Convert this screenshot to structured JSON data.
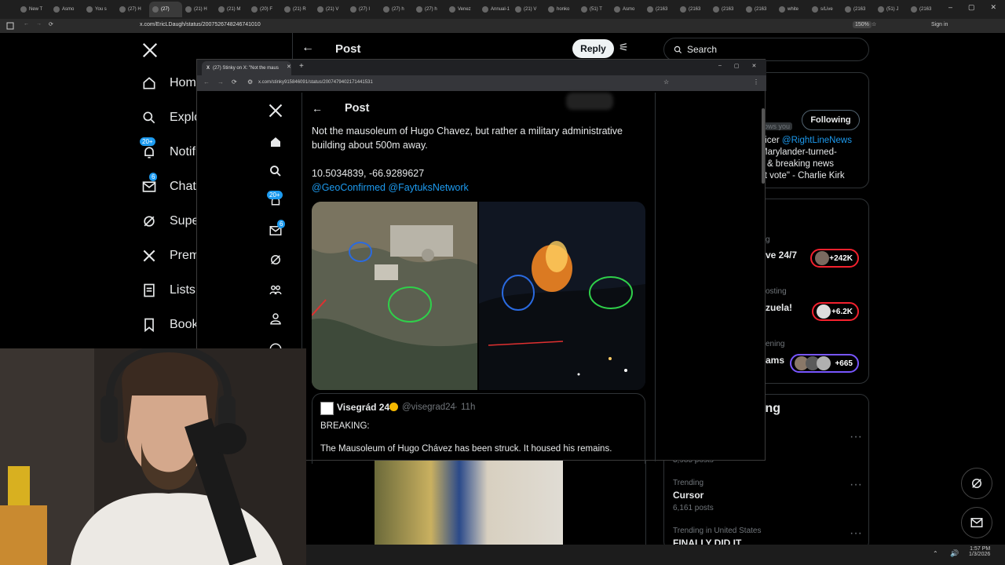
{
  "outer_browser": {
    "tabs": [
      "New T",
      "Asmo",
      "You s",
      "(27) H",
      "(27) ",
      "(21) H",
      "(21) M",
      "(20) F",
      "(21) R",
      "(21) V",
      "(27) I",
      "(27) h",
      "(27) h",
      "Venez",
      "Annual-1",
      "(21) V",
      "honko",
      "(51) T",
      "Asmo",
      "(2163",
      "(2163",
      "(2163",
      "(2163",
      "white",
      "s/Live",
      "(2163",
      "(51) J",
      "(2163"
    ],
    "url": "x.com/EricLDaugh/status/2007526748246741010",
    "zoom": "150%",
    "signin": "Sign in"
  },
  "bg_sidebar": {
    "items": [
      "Home",
      "Explore",
      "Notifications",
      "Chat",
      "Super",
      "Premium",
      "Lists",
      "Bookmarks"
    ],
    "notif_badge": "20+",
    "chat_badge": "6"
  },
  "bg_header": {
    "title": "Post",
    "reply": "Reply"
  },
  "search": {
    "placeholder": "Search"
  },
  "right_col": {
    "follow_card": {
      "button": "Following",
      "follows_you": "lows you",
      "bio_line1_prefix": "fficer ",
      "bio_handle": "@RightLineNews",
      "bio_line2": " Marylander-turned-",
      "bio_line3": "s & breaking news",
      "bio_line4": "st vote\" - Charlie Kirk"
    },
    "live": [
      {
        "label": "ve 24/7",
        "count": "+242K"
      },
      {
        "label": "zuela!",
        "count": "+6.2K"
      },
      {
        "label": "ams",
        "count": "+665"
      }
    ],
    "live_faint": [
      "g",
      "osting",
      "ening"
    ],
    "trending_heading": "ing",
    "trends": [
      {
        "context": "",
        "name": "",
        "posts": "3,985 posts"
      },
      {
        "context": "Trending",
        "name": "Cursor",
        "posts": "6,161 posts"
      },
      {
        "context": "Trending in United States",
        "name": "FINALLY DID IT",
        "posts": ""
      }
    ]
  },
  "popup": {
    "tab_title": "(27) Stinky on X: \"Not the maus",
    "url": "x.com/stinky915846091/status/2007479402171441531",
    "header_title": "Post",
    "notif_badge": "20+",
    "chat_badge": "6",
    "tweet": {
      "line1": "Not the mausoleum of Hugo Chavez, but rather a military administrative",
      "line2": "building about 500m away.",
      "coords": "10.5034839, -66.9289627",
      "mentions": "@GeoConfirmed @FaytuksNetwork"
    },
    "quote": {
      "name": "Visegrád 24",
      "handle": "@visegrad24",
      "sep": "·",
      "time": "11h",
      "text1": "BREAKING:",
      "text2": "The Mausoleum of Hugo Chávez has been struck. It housed his remains."
    }
  },
  "taskbar": {
    "time": "1:57 PM",
    "date": "1/3/2026"
  }
}
